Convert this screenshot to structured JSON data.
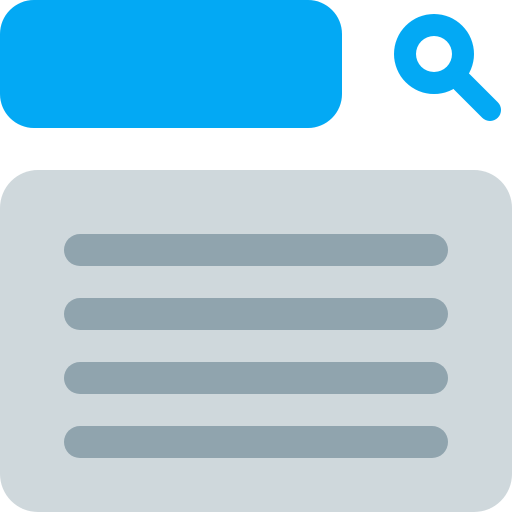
{
  "colors": {
    "accent": "#03a9f4",
    "panel": "#cfd8dc",
    "line": "#90a4ae",
    "background": "#ffffff"
  },
  "search": {
    "icon": "search-icon",
    "value": ""
  },
  "results": {
    "line_count": 4
  }
}
